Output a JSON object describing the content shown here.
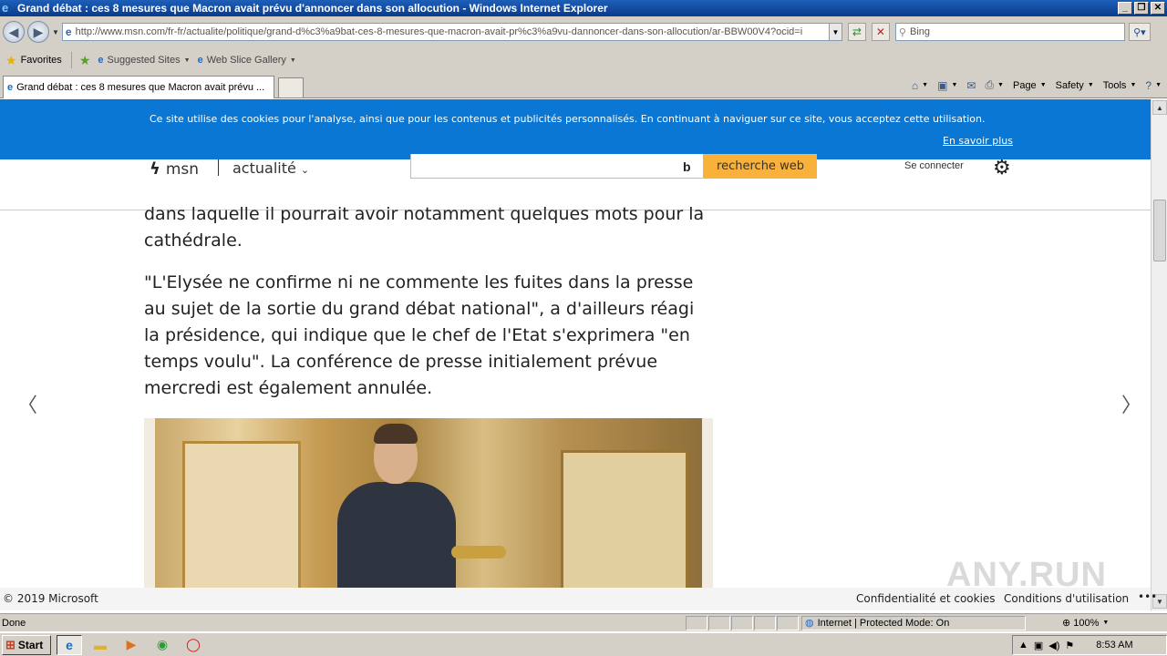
{
  "window": {
    "title": "Grand débat : ces 8 mesures que Macron avait prévu d'annoncer dans son allocution - Windows Internet Explorer",
    "controls": [
      "_",
      "❐",
      "✕"
    ]
  },
  "address_bar": {
    "url": "http://www.msn.com/fr-fr/actualite/politique/grand-d%c3%a9bat-ces-8-mesures-que-macron-avait-pr%c3%a9vu-dannoncer-dans-son-allocution/ar-BBW00V4?ocid=i",
    "search_placeholder": "Bing"
  },
  "favorites_bar": {
    "favorites_label": "Favorites",
    "suggested_sites": "Suggested Sites",
    "web_slice_gallery": "Web Slice Gallery"
  },
  "tab": {
    "title": "Grand débat : ces 8 mesures que Macron avait prévu ..."
  },
  "command_bar": {
    "page": "Page",
    "safety": "Safety",
    "tools": "Tools"
  },
  "cookie_banner": {
    "text": "Ce site utilise des cookies pour l'analyse, ainsi que pour les contenus et publicités personnalisés. En continuant à naviguer sur ce site, vous acceptez cette utilisation.",
    "link": "En savoir plus"
  },
  "msn_header": {
    "logo": "msn",
    "section": "actualité",
    "search_button": "recherche web",
    "sign_in": "Se connecter"
  },
  "article": {
    "paragraphs": [
      "dans laquelle il pourrait avoir notamment quelques mots pour la cathédrale.",
      "\"L'Elysée ne confirme ni ne commente les fuites dans la presse au sujet de la sortie du grand débat national\", a d'ailleurs réagi la présidence, qui indique que le chef de l'Etat s'exprimera \"en temps voulu\". La conférence de presse initialement prévue mercredi est également annulée."
    ]
  },
  "footer": {
    "copyright": "© 2019 Microsoft",
    "privacy": "Confidentialité et cookies",
    "terms": "Conditions d'utilisation",
    "more": "•••"
  },
  "watermark": "ANY.RUN",
  "status_bar": {
    "status": "Done",
    "zone": "Internet | Protected Mode: On",
    "zoom": "100%"
  },
  "taskbar": {
    "start": "Start",
    "clock": "8:53 AM"
  }
}
